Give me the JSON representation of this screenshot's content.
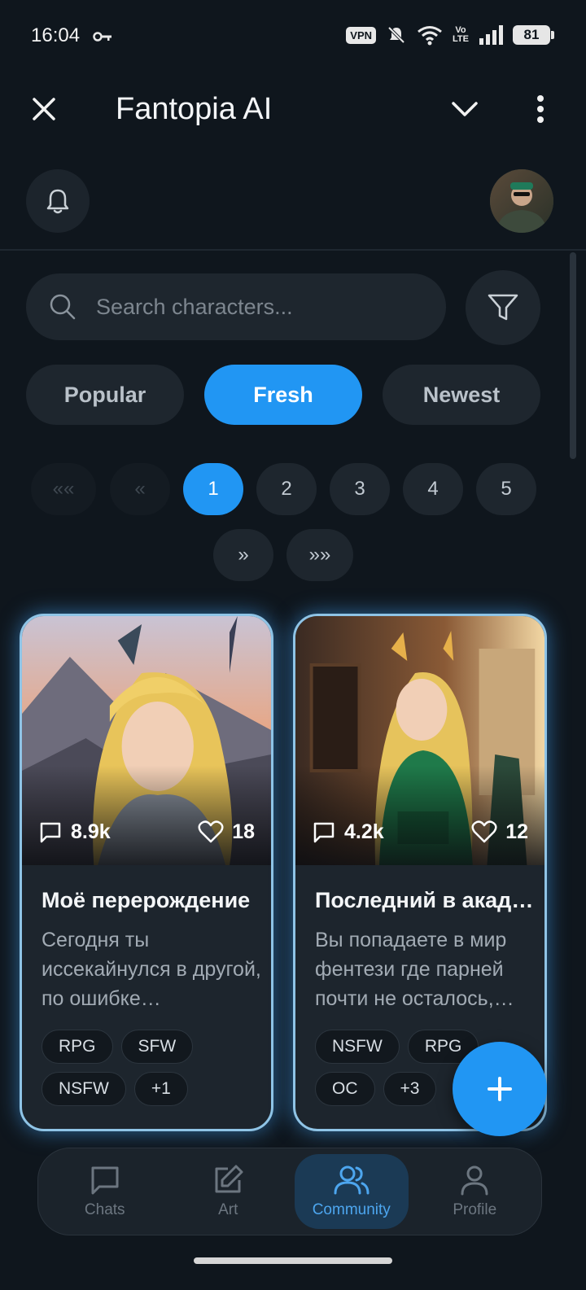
{
  "status_bar": {
    "time": "16:04",
    "vpn": "VPN",
    "volte_top": "Vo",
    "volte_bottom": "LTE",
    "battery": "81"
  },
  "header": {
    "title": "Fantopia AI"
  },
  "search": {
    "placeholder": "Search characters..."
  },
  "tabs": [
    {
      "label": "Popular",
      "active": false
    },
    {
      "label": "Fresh",
      "active": true
    },
    {
      "label": "Newest",
      "active": false
    }
  ],
  "pagination": {
    "first": "««",
    "prev": "«",
    "pages": [
      "1",
      "2",
      "3",
      "4",
      "5"
    ],
    "current": "1",
    "next": "»",
    "last": "»»"
  },
  "cards": [
    {
      "chats": "8.9k",
      "likes": "18",
      "title": "Моё перерождение",
      "description": "Сегодня ты иссекайнулся в другой, по ошибке…",
      "tags": [
        "RPG",
        "SFW",
        "NSFW",
        "+1"
      ]
    },
    {
      "chats": "4.2k",
      "likes": "12",
      "title": "Последний в академии",
      "description": "Вы попадаете в мир фентези где парней почти не осталось,…",
      "tags": [
        "NSFW",
        "RPG",
        "OC",
        "+3"
      ]
    }
  ],
  "fab": {
    "icon": "plus-icon"
  },
  "bottom_nav": [
    {
      "label": "Chats",
      "icon": "chat-icon",
      "active": false
    },
    {
      "label": "Art",
      "icon": "edit-icon",
      "active": false
    },
    {
      "label": "Community",
      "icon": "users-icon",
      "active": true
    },
    {
      "label": "Profile",
      "icon": "user-icon",
      "active": false
    }
  ],
  "colors": {
    "accent": "#2196f3",
    "background": "#0f161d",
    "card_glow": "#8fc4e6"
  }
}
